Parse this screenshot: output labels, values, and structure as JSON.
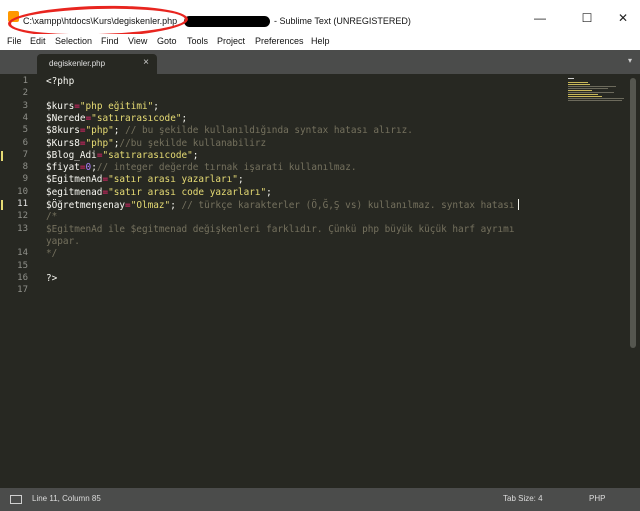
{
  "window": {
    "path": "C:\\xampp\\htdocs\\Kurs\\degiskenler.php",
    "app_title": "- Sublime Text (UNREGISTERED)",
    "minimize_glyph": "—",
    "maximize_glyph": "☐",
    "close_glyph": "✕"
  },
  "menu": {
    "items": [
      "File",
      "Edit",
      "Selection",
      "Find",
      "View",
      "Goto",
      "Tools",
      "Project",
      "Preferences",
      "Help"
    ]
  },
  "tabs": {
    "active_label": "degiskenler.php",
    "close_glyph": "×",
    "dropdown_glyph": "▾"
  },
  "editor": {
    "current_line": 11,
    "modified_lines": [
      7,
      11
    ],
    "line_numbers": [
      "1",
      "2",
      "3",
      "4",
      "5",
      "6",
      "7",
      "8",
      "9",
      "10",
      "11",
      "12",
      "13",
      "",
      "14",
      "15",
      "16",
      "17"
    ],
    "lines": [
      [
        {
          "t": "<?php",
          "c": "tag"
        }
      ],
      [],
      [
        {
          "t": "$kurs",
          "c": "var"
        },
        {
          "t": "=",
          "c": "op"
        },
        {
          "t": "\"php eğitimi\"",
          "c": "str"
        },
        {
          "t": ";",
          "c": "punc"
        }
      ],
      [
        {
          "t": "$Nerede",
          "c": "var"
        },
        {
          "t": "=",
          "c": "op"
        },
        {
          "t": "\"satırarasıcode\"",
          "c": "str"
        },
        {
          "t": ";",
          "c": "punc"
        }
      ],
      [
        {
          "t": "$8kurs",
          "c": "var"
        },
        {
          "t": "=",
          "c": "op"
        },
        {
          "t": "\"php\"",
          "c": "str"
        },
        {
          "t": "; ",
          "c": "punc"
        },
        {
          "t": "// bu şekilde kullanıldığında syntax hatası alırız.",
          "c": "com"
        }
      ],
      [
        {
          "t": "$Kurs8",
          "c": "var"
        },
        {
          "t": "=",
          "c": "op"
        },
        {
          "t": "\"php\"",
          "c": "str"
        },
        {
          "t": ";",
          "c": "punc"
        },
        {
          "t": "//bu şekilde kullanabilirz",
          "c": "com"
        }
      ],
      [
        {
          "t": "$Blog_Adi",
          "c": "var"
        },
        {
          "t": "=",
          "c": "op"
        },
        {
          "t": "\"satırarasıcode\"",
          "c": "str"
        },
        {
          "t": ";",
          "c": "punc"
        }
      ],
      [
        {
          "t": "$fiyat",
          "c": "var"
        },
        {
          "t": "=",
          "c": "op"
        },
        {
          "t": "0",
          "c": "num"
        },
        {
          "t": ";",
          "c": "punc"
        },
        {
          "t": "// integer değerde tırnak işarati kullanılmaz.",
          "c": "com"
        }
      ],
      [
        {
          "t": "$EgitmenAd",
          "c": "var"
        },
        {
          "t": "=",
          "c": "op"
        },
        {
          "t": "\"satır arası yazarları\"",
          "c": "str"
        },
        {
          "t": ";",
          "c": "punc"
        }
      ],
      [
        {
          "t": "$egitmenad",
          "c": "var"
        },
        {
          "t": "=",
          "c": "op"
        },
        {
          "t": "\"satır arası code yazarları\"",
          "c": "str"
        },
        {
          "t": ";",
          "c": "punc"
        }
      ],
      [
        {
          "t": "$Öğretmenşenay",
          "c": "var"
        },
        {
          "t": "=",
          "c": "op"
        },
        {
          "t": "\"Olmaz\"",
          "c": "str"
        },
        {
          "t": "; ",
          "c": "punc"
        },
        {
          "t": "// türkçe karakterler (Ö,Ğ,Ş vs) kullanılmaz. syntax hatası",
          "c": "com"
        }
      ],
      [
        {
          "t": "/*",
          "c": "com"
        }
      ],
      [
        {
          "t": "$EgitmenAd ile $egitmenad değişkenleri farklıdır. Çünkü php büyük küçük harf ayrımı",
          "c": "com"
        }
      ],
      [
        {
          "t": "yapar.",
          "c": "com"
        }
      ],
      [
        {
          "t": "*/",
          "c": "com"
        }
      ],
      [],
      [
        {
          "t": "?>",
          "c": "tag"
        }
      ],
      []
    ]
  },
  "status": {
    "position": "Line 11, Column 85",
    "tab_size": "Tab Size: 4",
    "syntax": "PHP"
  },
  "colors": {
    "editor_bg": "#272822",
    "keyword": "#f92672",
    "string": "#e6db74",
    "number": "#ae81ff",
    "comment": "#75715e",
    "annotation_circle": "#e8251f"
  },
  "icons": {
    "app": "sublime-text-icon",
    "status": "panel-toggle-icon"
  }
}
